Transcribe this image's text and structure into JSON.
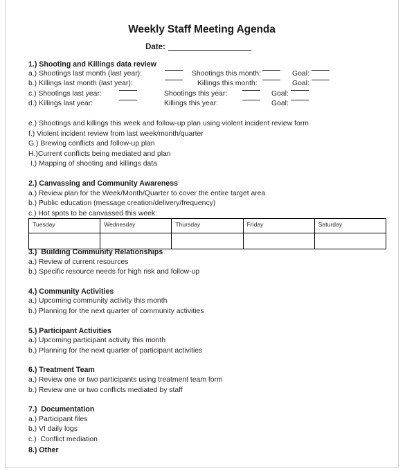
{
  "document": {
    "title": "Weekly Staff Meeting Agenda",
    "date_label": "Date:",
    "date_value": ""
  },
  "sections": [
    {
      "heading": "1.) Shooting and Killings data review",
      "data_rows": [
        {
          "label": "a.) Shootings last month (last year):",
          "mid": "Shootings this month:",
          "goal": "Goal:"
        },
        {
          "label": "b.) Killings last month (last year):",
          "mid": "Killings this month:",
          "goal": "Goal:"
        },
        {
          "label": "c.) Shootings last year:",
          "mid": "Shootings this year:",
          "goal": "Goal:"
        },
        {
          "label": "d.) Killings last year:",
          "mid": "Killings this year:",
          "goal": "Goal:"
        }
      ],
      "items": [
        "e.) Shootings and killings this week and follow-up plan using violent incident review form",
        "f.) Violent incident review from last week/month/quarter",
        "G.) Brewing conflicts and follow-up plan",
        "H.)Current conflicts being mediated and plan",
        " I.) Mapping of shooting and killings data"
      ]
    },
    {
      "heading": "2.) Canvassing and Community Awareness",
      "items": [
        "a.) Review plan for the Week/Month/Quarter to cover the entire target area",
        "b.) Public education (message creation/delivery/frequency)",
        "c.) Hot spots to be canvassed this week:"
      ]
    },
    {
      "heading": "3.)  Building Community Relationships",
      "items": [
        "a.) Review of current resources",
        "b.) Specific resource needs for high risk and follow-up"
      ]
    },
    {
      "heading": "4.) Community Activities",
      "items": [
        "a.) Upcoming community activity this month",
        "b.) Planning for the next quarter of community activities"
      ]
    },
    {
      "heading": "5.) Participant Activities",
      "items": [
        "a.) Upcoming participant activity this month",
        "b.) Planning for the next quarter of participant activities"
      ]
    },
    {
      "heading": "6.) Treatment Team",
      "items": [
        "a.) Review one or two participants using treatment team form",
        "b.) Review one or two conflicts mediated by staff"
      ]
    },
    {
      "heading": "7.)  Documentation",
      "items": [
        "a.) Participant files",
        "b.) VI daily logs",
        "c.)  Conflict mediation"
      ]
    },
    {
      "heading": "8.) Other",
      "items": []
    }
  ],
  "week_table": {
    "headers": [
      "Tuesday",
      "Wednesday",
      "Thursday",
      "Friday",
      "Saturday"
    ],
    "rows": [
      [
        "",
        "",
        "",
        "",
        ""
      ]
    ]
  },
  "colors": {
    "text": "#262323",
    "heading": "#1a1a1a",
    "page_border": "#d2d2d2",
    "table_border": "#000000",
    "background": "#ffffff"
  }
}
